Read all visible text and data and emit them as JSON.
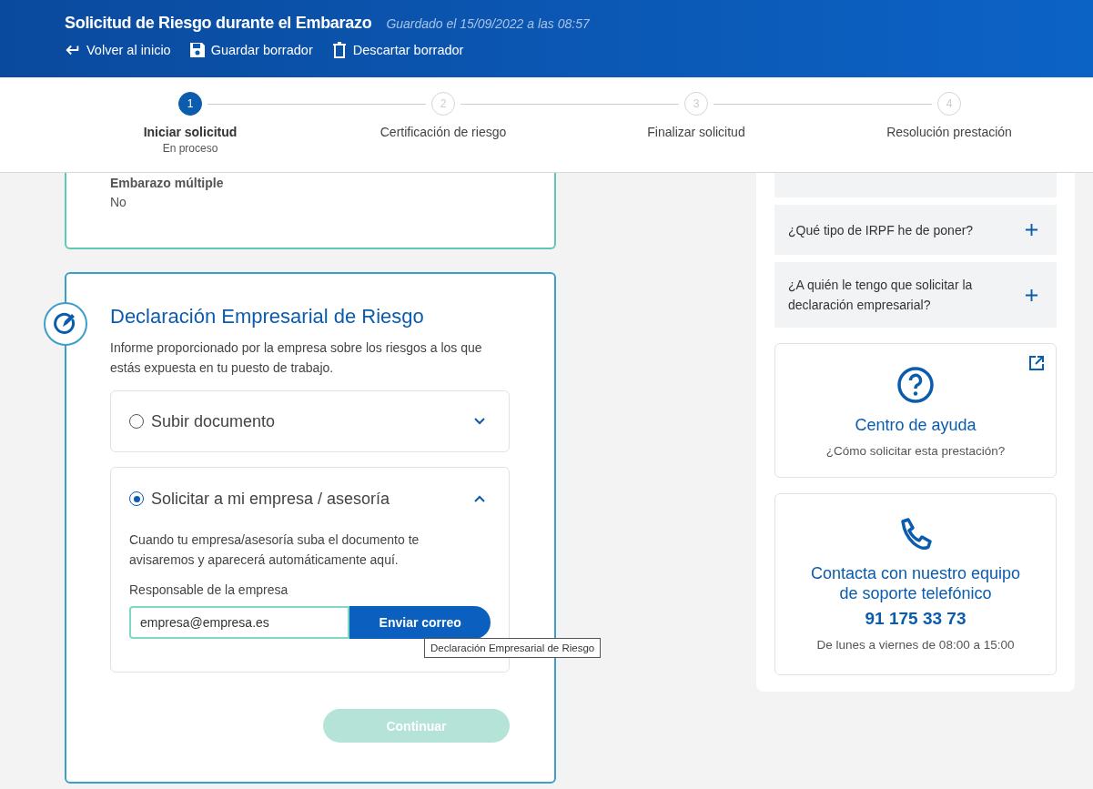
{
  "header": {
    "title": "Solicitud de Riesgo durante el Embarazo",
    "saved": "Guardado el 15/09/2022 a las 08:57",
    "actions": [
      {
        "label": "Volver al inicio",
        "kind": "back"
      },
      {
        "label": "Guardar borrador",
        "kind": "save"
      },
      {
        "label": "Descartar borrador",
        "kind": "trash"
      }
    ]
  },
  "steps": [
    {
      "number": "1",
      "label": "Iniciar solicitud",
      "status": "En proceso",
      "selected": true
    },
    {
      "number": "2",
      "label": "Certificación de riesgo",
      "selected": false
    },
    {
      "number": "3",
      "label": "Finalizar solicitud",
      "selected": false
    },
    {
      "number": "4",
      "label": "Resolución prestación",
      "selected": false
    }
  ],
  "summary_card": {
    "fields": [
      {
        "label": "Embarazo múltiple",
        "value": "No"
      }
    ]
  },
  "section": {
    "title": "Declaración Empresarial de Riesgo",
    "description": "Informe proporcionado por la empresa sobre los riesgos a los que estás expuesta en tu puesto de trabajo.",
    "options": [
      {
        "label": "Subir documento",
        "selected": false,
        "expanded": false
      },
      {
        "label": "Solicitar a mi empresa / asesoría",
        "selected": true,
        "expanded": true,
        "description": "Cuando tu empresa/asesoría suba el documento te avisaremos y aparecerá automáticamente aquí.",
        "field_label": "Responsable de la empresa",
        "field_value": "empresa@empresa.es",
        "button": "Enviar correo"
      }
    ],
    "continue_button": {
      "label": "Continuar",
      "disabled": true
    }
  },
  "tooltip": "Declaración Empresarial de Riesgo",
  "faq": [
    {
      "question": "¿Qué tipo de IRPF he de poner?",
      "expanded": false
    },
    {
      "question": "¿A quién le tengo que solicitar la declaración empresarial?",
      "expanded": false
    }
  ],
  "help_card": {
    "title": "Centro de ayuda",
    "subtitle": "¿Cómo solicitar esta prestación?"
  },
  "contact_card": {
    "title": "Contacta con nuestro equipo de soporte telefónico",
    "phone": "91 175 33 73",
    "hours": "De lunes a viernes de 08:00 a 15:00"
  }
}
